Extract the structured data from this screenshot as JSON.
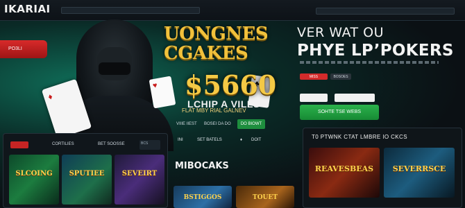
{
  "brand": {
    "logo": "IKARIAI"
  },
  "promo_pill": "PO3LI",
  "hero": {
    "title_line1": "UONGNES",
    "title_line2": "CGAKES",
    "amount": "$5660",
    "chip_line": "LCHIP A VILLS",
    "sub_line": "FLAT MBY RIAL GALNEV",
    "tabs": [
      "VIIIE IIEST",
      "BOSEI DA DO"
    ],
    "active_tab": "DO BIOWT"
  },
  "right_hero": {
    "line1": "VER WAT OU",
    "line2": "PHYE LP’POKERS",
    "red_button": "MISS",
    "grey_button": "BOSOES",
    "green_button": "SOHTE TSE WEBS"
  },
  "games_panel": {
    "tabs": [
      "CORTILIES",
      "BET SOOSSE"
    ],
    "side_box": "BCS",
    "tiles": [
      "SLCOING",
      "SPUTIEE",
      "SEVEIRT"
    ]
  },
  "mid_bottom": {
    "row": [
      "INI",
      "SET BATELS",
      "♦",
      "DOIT"
    ],
    "title": "MIBOCAKS",
    "tiles": [
      "BSTIGGOS",
      "TOUET"
    ]
  },
  "right_panel": {
    "title": "T0 PTWNK CTAT LMBRE IO CKCS",
    "tiles": [
      "REAVESBEAS",
      "SEVERRSCE"
    ]
  },
  "colors": {
    "accent_green": "#1e8e3e",
    "accent_red": "#d32b2b",
    "gold": "#f1c13b"
  }
}
